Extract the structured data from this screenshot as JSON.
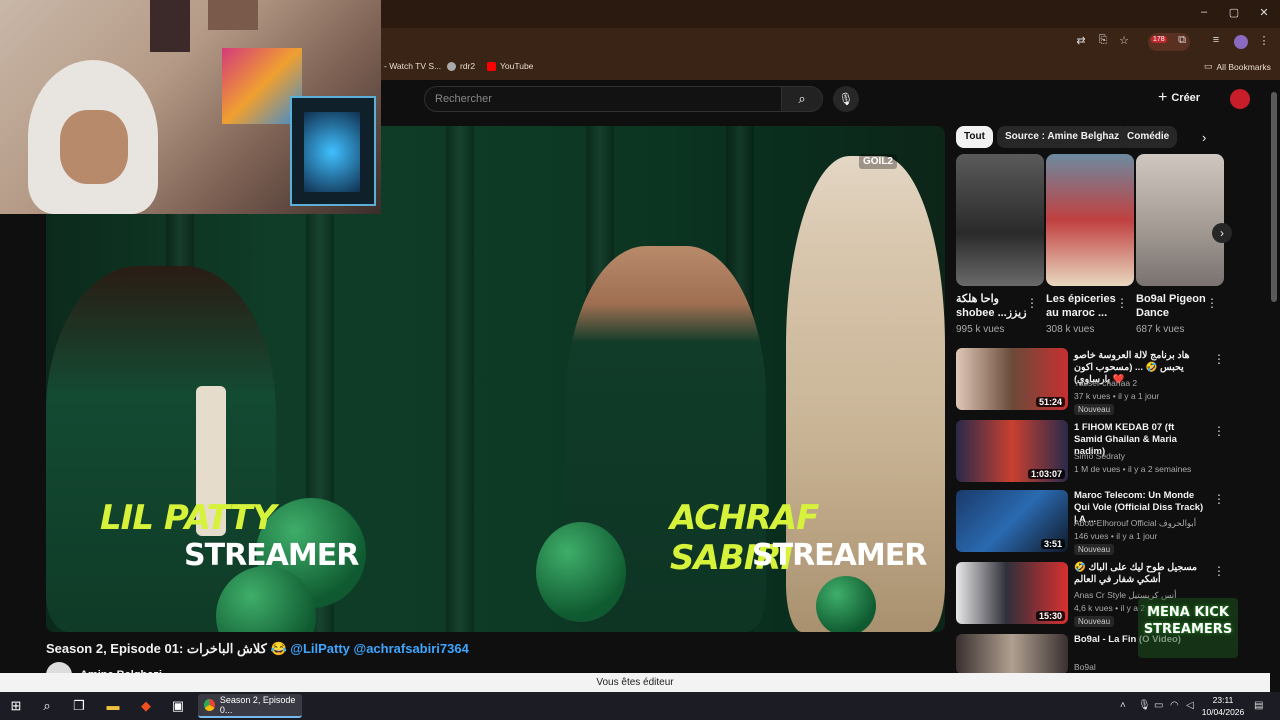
{
  "browser": {
    "bookmarks": [
      {
        "label": "- Watch TV S...",
        "icon": "tv-icon"
      },
      {
        "label": "rdr2",
        "icon": "globe-icon"
      },
      {
        "label": "YouTube",
        "icon": "youtube-icon",
        "color": "#ff0000"
      }
    ],
    "all_bookmarks": "All Bookmarks",
    "extension_badge": "178"
  },
  "header": {
    "search_placeholder": "Rechercher",
    "create_label": "Créer"
  },
  "video": {
    "left_name": "LIL PATTY",
    "left_role": "STREAMER",
    "right_name": "ACHRAF SABIRI",
    "right_role": "STREAMER",
    "corner_logo": "GOIL2"
  },
  "watch": {
    "title": "Season 2, Episode 01: كلاش الباخرات 😂",
    "handles": "@LilPatty @achrafsabiri7364",
    "channel": "Amine Belghazi"
  },
  "chips": [
    "Tout",
    "Source : Amine Belghazi",
    "Comédie"
  ],
  "shorts": [
    {
      "title": "واحا هلكة shobee ...زيزز",
      "views": "995 k vues"
    },
    {
      "title": "Les épiceries au maroc ...",
      "views": "308 k vues"
    },
    {
      "title": "Bo9al Pigeon Dance",
      "views": "687 k vues"
    }
  ],
  "recommendations": [
    {
      "title": "هاد برنامج لالة العروسة خاصو يحبس 🤣 ... (مسحوب اكون بارساوي) ❤️",
      "channel": "Yasser chanaa 2",
      "meta": "37 k vues • il y a 1 jour",
      "badge": "Nouveau",
      "duration": "51:24"
    },
    {
      "title": "1 FIHOM KEDAB 07 (ft Samid Ghailan & Maria nadim)",
      "channel": "Simo Sedraty",
      "meta": "1 M de vues • il y a 2 semaines",
      "badge": "",
      "duration": "1:03:07"
    },
    {
      "title": "Maroc Telecom: Un Monde Qui Vole (Official Diss Track) | A ...",
      "channel": "Abou-Elhorouf Official أبوالحروف",
      "meta": "146 vues • il y a 1 jour",
      "badge": "Nouveau",
      "duration": "3:51"
    },
    {
      "title": "مسجيل طوح ليك على الباك 🤣 أشكي شفار في العالم",
      "channel": "Anas Cr Style أنس كريستيل",
      "meta": "4,6 k vues • il y a 2",
      "badge": "Nouveau",
      "duration": "15:30"
    },
    {
      "title": "Bo9al - La Fin (O Video)",
      "channel": "Bo9al",
      "meta": "",
      "badge": "",
      "duration": ""
    }
  ],
  "overlay_logo": "MENA KICK STREAMERS",
  "editor_bar": "Vous êtes éditeur",
  "taskbar": {
    "chrome_tab": "Season 2, Episode 0...",
    "time": "23:11",
    "date": "10/04/2026"
  }
}
